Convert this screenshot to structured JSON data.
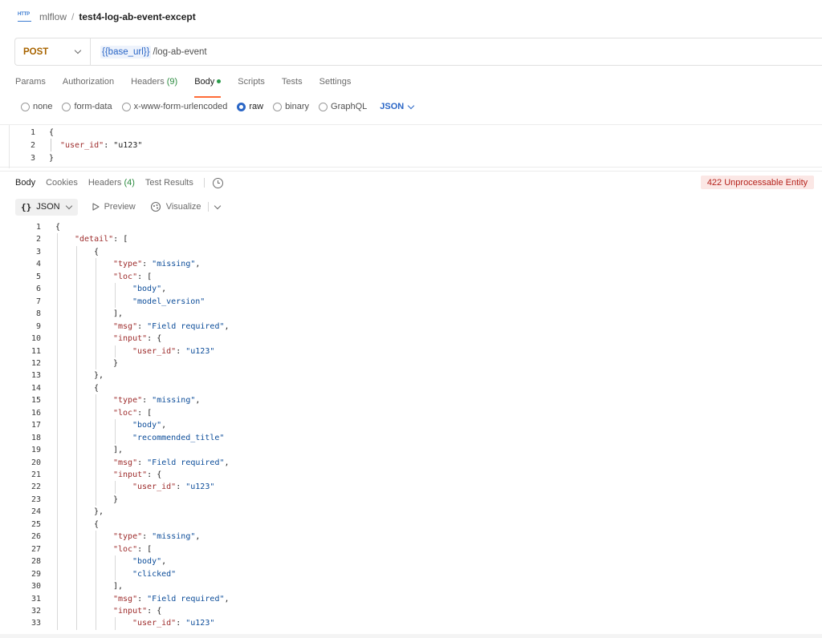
{
  "breadcrumb": {
    "icon_text": "HTTP",
    "collection": "mlflow",
    "separator": "/",
    "request": "test4-log-ab-event-except"
  },
  "request": {
    "method": "POST",
    "url_variable": "{{base_url}}",
    "url_path": "/log-ab-event"
  },
  "request_tabs": [
    {
      "label": "Params"
    },
    {
      "label": "Authorization"
    },
    {
      "label": "Headers",
      "count": "(9)"
    },
    {
      "label": "Body",
      "active": true
    },
    {
      "label": "Scripts"
    },
    {
      "label": "Tests"
    },
    {
      "label": "Settings"
    }
  ],
  "body_types": {
    "options": [
      "none",
      "form-data",
      "x-www-form-urlencoded",
      "raw",
      "binary",
      "GraphQL"
    ],
    "selected": "raw",
    "language": "JSON"
  },
  "request_body": {
    "line_numbers": [
      "1",
      "2",
      "3"
    ],
    "line1": "{",
    "line2_key": "\"user_id\"",
    "line2_sep": ": ",
    "line2_value": "\"u123\"",
    "line3": "}"
  },
  "response_tabs": {
    "body": "Body",
    "cookies": "Cookies",
    "headers": "Headers",
    "headers_count": "(4)",
    "test_results": "Test Results"
  },
  "status": "422 Unprocessable Entity",
  "response_toolbar": {
    "format": "JSON",
    "preview": "Preview",
    "visualize": "Visualize"
  },
  "response_body": [
    {
      "n": "1",
      "indent": 0,
      "tokens": [
        [
          "p",
          "{"
        ]
      ]
    },
    {
      "n": "2",
      "indent": 1,
      "tokens": [
        [
          "k",
          "\"detail\""
        ],
        [
          "p",
          ": ["
        ]
      ]
    },
    {
      "n": "3",
      "indent": 2,
      "tokens": [
        [
          "p",
          "{"
        ]
      ]
    },
    {
      "n": "4",
      "indent": 3,
      "tokens": [
        [
          "k",
          "\"type\""
        ],
        [
          "p",
          ": "
        ],
        [
          "s",
          "\"missing\""
        ],
        [
          "p",
          ","
        ]
      ]
    },
    {
      "n": "5",
      "indent": 3,
      "tokens": [
        [
          "k",
          "\"loc\""
        ],
        [
          "p",
          ": ["
        ]
      ]
    },
    {
      "n": "6",
      "indent": 4,
      "tokens": [
        [
          "s",
          "\"body\""
        ],
        [
          "p",
          ","
        ]
      ]
    },
    {
      "n": "7",
      "indent": 4,
      "tokens": [
        [
          "s",
          "\"model_version\""
        ]
      ]
    },
    {
      "n": "8",
      "indent": 3,
      "tokens": [
        [
          "p",
          "],"
        ]
      ]
    },
    {
      "n": "9",
      "indent": 3,
      "tokens": [
        [
          "k",
          "\"msg\""
        ],
        [
          "p",
          ": "
        ],
        [
          "s",
          "\"Field required\""
        ],
        [
          "p",
          ","
        ]
      ]
    },
    {
      "n": "10",
      "indent": 3,
      "tokens": [
        [
          "k",
          "\"input\""
        ],
        [
          "p",
          ": {"
        ]
      ]
    },
    {
      "n": "11",
      "indent": 4,
      "tokens": [
        [
          "k",
          "\"user_id\""
        ],
        [
          "p",
          ": "
        ],
        [
          "s",
          "\"u123\""
        ]
      ]
    },
    {
      "n": "12",
      "indent": 3,
      "tokens": [
        [
          "p",
          "}"
        ]
      ]
    },
    {
      "n": "13",
      "indent": 2,
      "tokens": [
        [
          "p",
          "},"
        ]
      ]
    },
    {
      "n": "14",
      "indent": 2,
      "tokens": [
        [
          "p",
          "{"
        ]
      ]
    },
    {
      "n": "15",
      "indent": 3,
      "tokens": [
        [
          "k",
          "\"type\""
        ],
        [
          "p",
          ": "
        ],
        [
          "s",
          "\"missing\""
        ],
        [
          "p",
          ","
        ]
      ]
    },
    {
      "n": "16",
      "indent": 3,
      "tokens": [
        [
          "k",
          "\"loc\""
        ],
        [
          "p",
          ": ["
        ]
      ]
    },
    {
      "n": "17",
      "indent": 4,
      "tokens": [
        [
          "s",
          "\"body\""
        ],
        [
          "p",
          ","
        ]
      ]
    },
    {
      "n": "18",
      "indent": 4,
      "tokens": [
        [
          "s",
          "\"recommended_title\""
        ]
      ]
    },
    {
      "n": "19",
      "indent": 3,
      "tokens": [
        [
          "p",
          "],"
        ]
      ]
    },
    {
      "n": "20",
      "indent": 3,
      "tokens": [
        [
          "k",
          "\"msg\""
        ],
        [
          "p",
          ": "
        ],
        [
          "s",
          "\"Field required\""
        ],
        [
          "p",
          ","
        ]
      ]
    },
    {
      "n": "21",
      "indent": 3,
      "tokens": [
        [
          "k",
          "\"input\""
        ],
        [
          "p",
          ": {"
        ]
      ]
    },
    {
      "n": "22",
      "indent": 4,
      "tokens": [
        [
          "k",
          "\"user_id\""
        ],
        [
          "p",
          ": "
        ],
        [
          "s",
          "\"u123\""
        ]
      ]
    },
    {
      "n": "23",
      "indent": 3,
      "tokens": [
        [
          "p",
          "}"
        ]
      ]
    },
    {
      "n": "24",
      "indent": 2,
      "tokens": [
        [
          "p",
          "},"
        ]
      ]
    },
    {
      "n": "25",
      "indent": 2,
      "tokens": [
        [
          "p",
          "{"
        ]
      ]
    },
    {
      "n": "26",
      "indent": 3,
      "tokens": [
        [
          "k",
          "\"type\""
        ],
        [
          "p",
          ": "
        ],
        [
          "s",
          "\"missing\""
        ],
        [
          "p",
          ","
        ]
      ]
    },
    {
      "n": "27",
      "indent": 3,
      "tokens": [
        [
          "k",
          "\"loc\""
        ],
        [
          "p",
          ": ["
        ]
      ]
    },
    {
      "n": "28",
      "indent": 4,
      "tokens": [
        [
          "s",
          "\"body\""
        ],
        [
          "p",
          ","
        ]
      ]
    },
    {
      "n": "29",
      "indent": 4,
      "tokens": [
        [
          "s",
          "\"clicked\""
        ]
      ]
    },
    {
      "n": "30",
      "indent": 3,
      "tokens": [
        [
          "p",
          "],"
        ]
      ]
    },
    {
      "n": "31",
      "indent": 3,
      "tokens": [
        [
          "k",
          "\"msg\""
        ],
        [
          "p",
          ": "
        ],
        [
          "s",
          "\"Field required\""
        ],
        [
          "p",
          ","
        ]
      ]
    },
    {
      "n": "32",
      "indent": 3,
      "tokens": [
        [
          "k",
          "\"input\""
        ],
        [
          "p",
          ": {"
        ]
      ]
    },
    {
      "n": "33",
      "indent": 4,
      "tokens": [
        [
          "k",
          "\"user_id\""
        ],
        [
          "p",
          ": "
        ],
        [
          "s",
          "\"u123\""
        ]
      ]
    }
  ],
  "colors": {
    "accent": "#ff6c37",
    "method": "#a86400",
    "link": "#2a66c6",
    "json_key": "#9d2b2b",
    "json_string": "#0b4c99",
    "status_text": "#b5221c",
    "status_bg": "#fbe7e5",
    "count_green": "#2a8a3e"
  }
}
